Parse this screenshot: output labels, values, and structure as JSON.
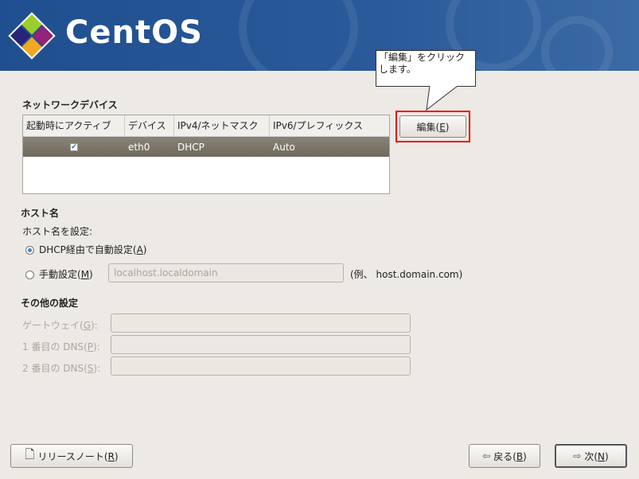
{
  "brand": {
    "name": "CentOS"
  },
  "callout": {
    "text": "「編集」をクリックします。"
  },
  "network": {
    "title": "ネットワークデバイス",
    "columns": [
      "起動時にアクティブ",
      "デバイス",
      "IPv4/ネットマスク",
      "IPv6/プレフィックス"
    ],
    "rows": [
      {
        "active": true,
        "device": "eth0",
        "ipv4": "DHCP",
        "ipv6": "Auto"
      }
    ],
    "edit": {
      "pre": "編集(",
      "key": "E",
      "post": ")"
    }
  },
  "hostname": {
    "title": "ホスト名",
    "set_label": "ホスト名を設定:",
    "dhcp": {
      "pre": "DHCP経由で自動設定(",
      "key": "A",
      "post": ")",
      "selected": true
    },
    "manual": {
      "pre": "手動設定(",
      "key": "M",
      "post": ")",
      "selected": false
    },
    "placeholder": "localhost.localdomain",
    "example": "(例、 host.domain.com)"
  },
  "other": {
    "title": "その他の設定",
    "gateway": {
      "pre": "ゲートウェイ(",
      "key": "G",
      "post": "):"
    },
    "dns1": {
      "pre": "1 番目の DNS(",
      "key": "P",
      "post": "):"
    },
    "dns2": {
      "pre": "2 番目の DNS(",
      "key": "S",
      "post": "):"
    }
  },
  "footer": {
    "release": {
      "pre": "リリースノート(",
      "key": "R",
      "post": ")"
    },
    "back": {
      "pre": "戻る(",
      "key": "B",
      "post": ")"
    },
    "next": {
      "pre": "次(",
      "key": "N",
      "post": ")"
    }
  }
}
